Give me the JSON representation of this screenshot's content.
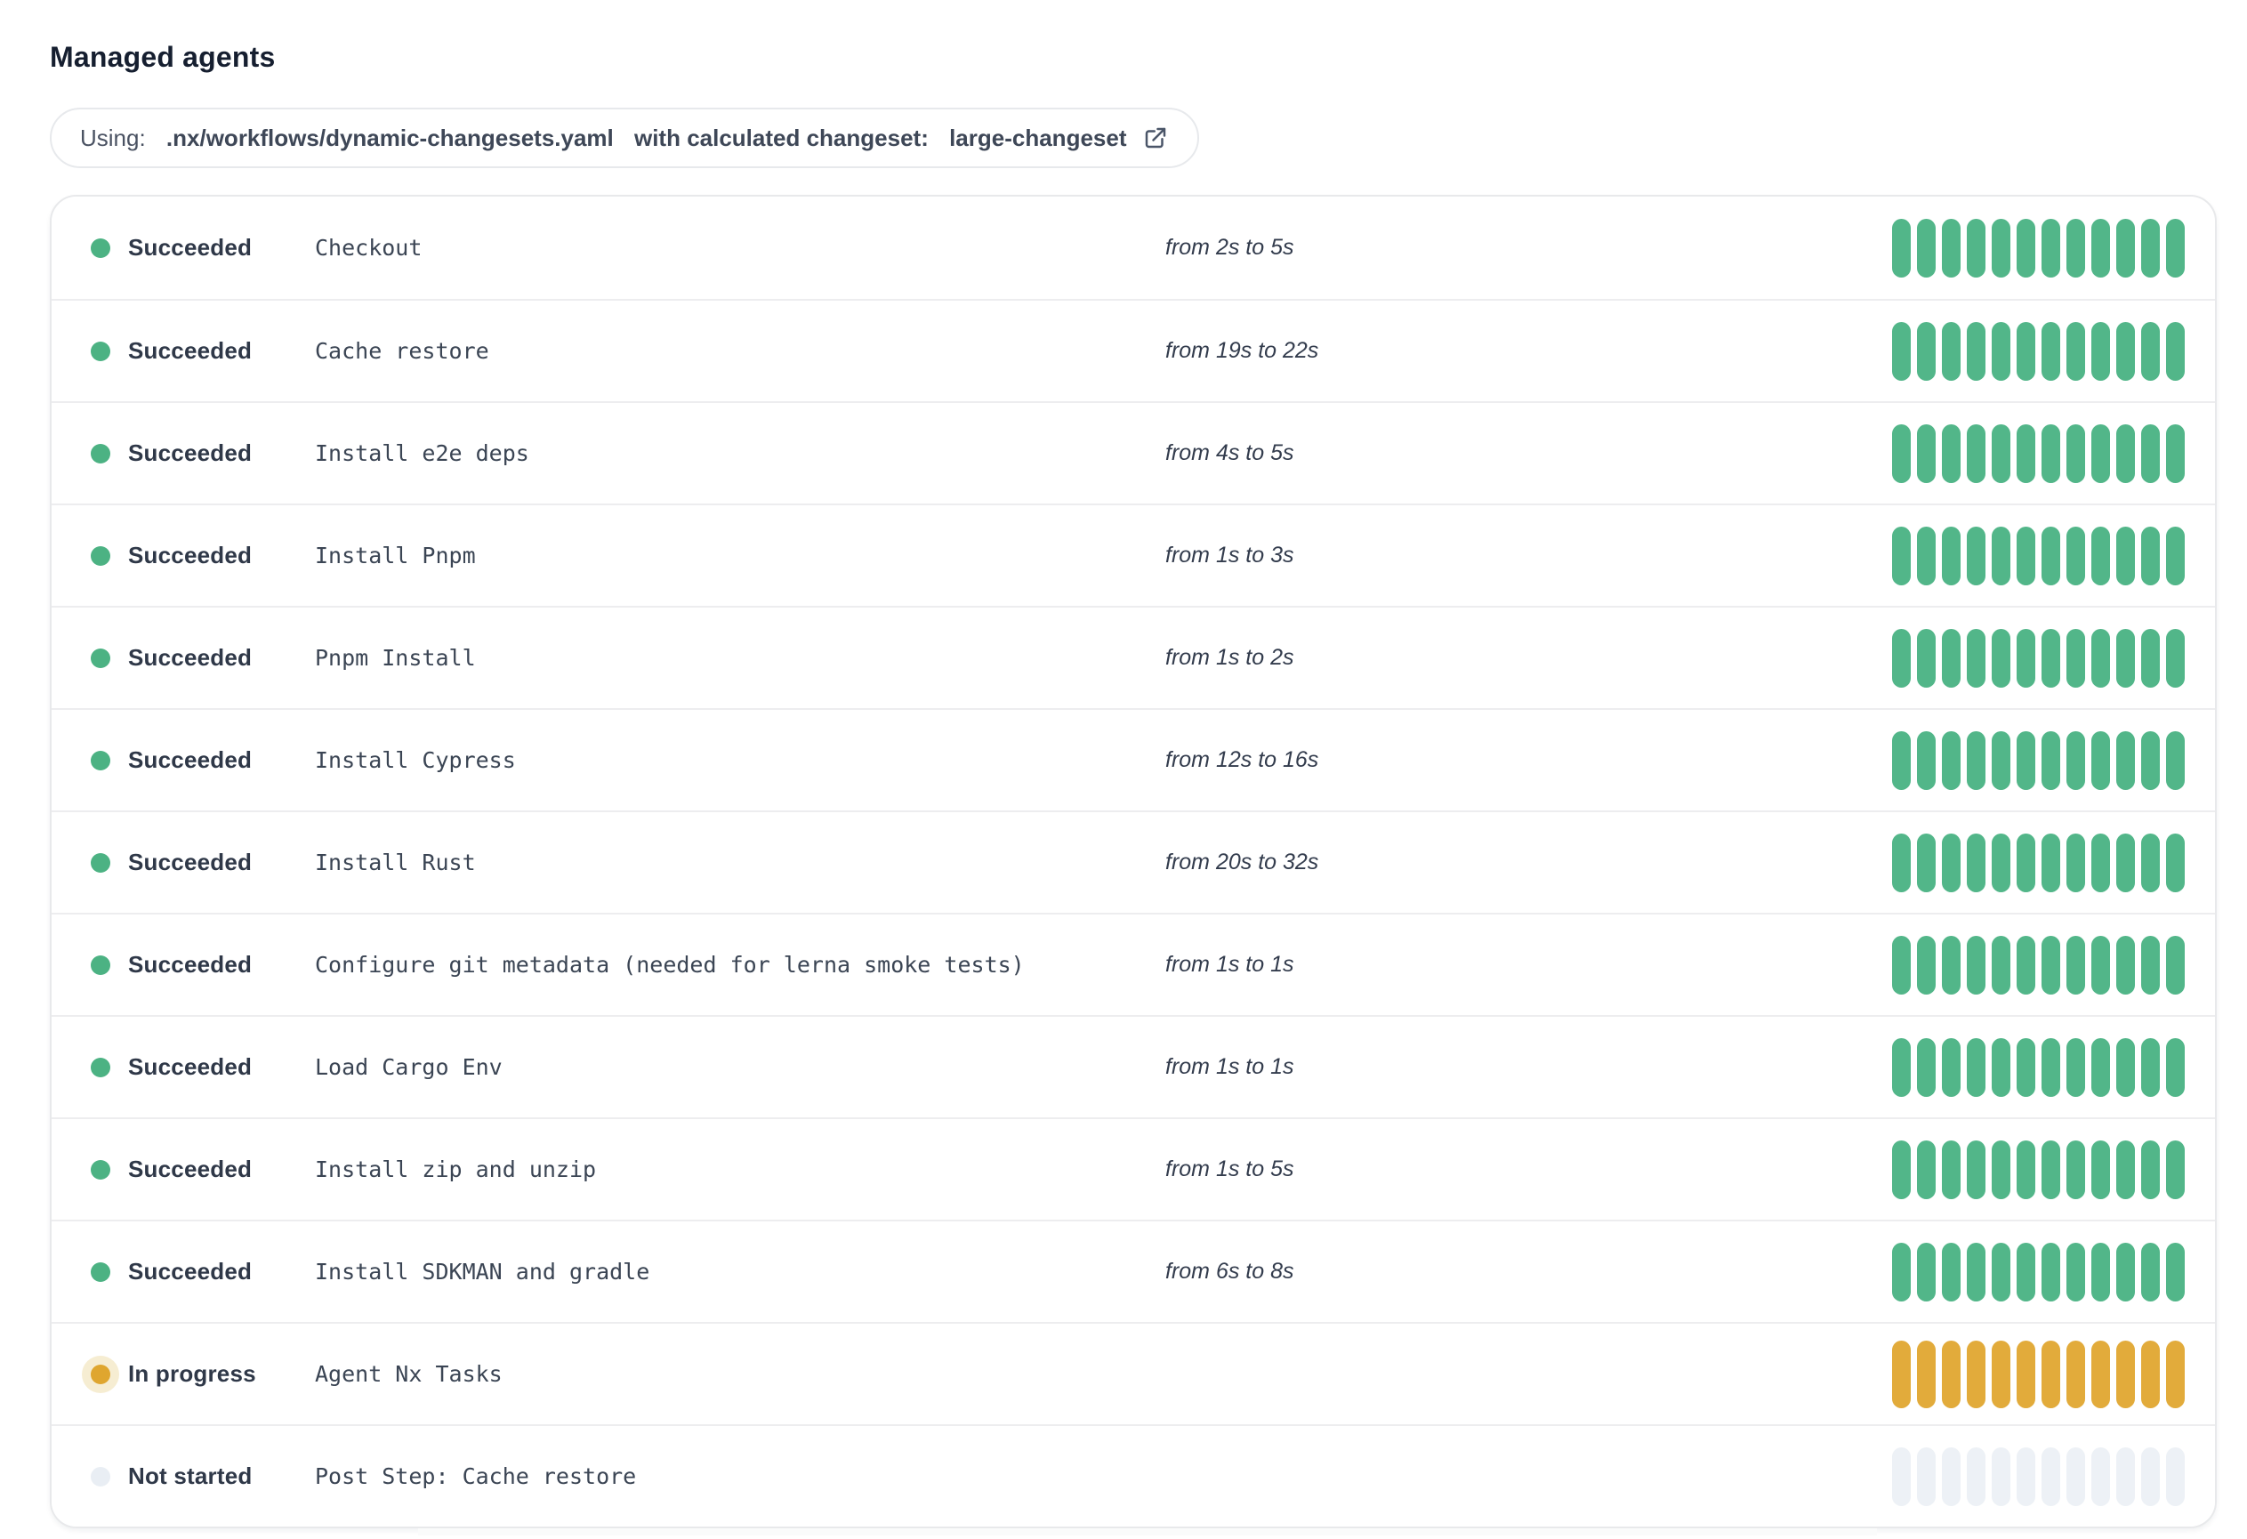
{
  "page": {
    "title": "Managed agents"
  },
  "workflow_banner": {
    "prefix": "Using: ",
    "workflow_file": ".nx/workflows/dynamic-changesets.yaml",
    "middle": " with calculated changeset: ",
    "changeset": "large-changeset",
    "icon": "external-link-icon"
  },
  "colors": {
    "succeeded_dot": "#4cb283",
    "succeeded_bar": "#52b689",
    "in_progress_dot": "#dfa62f",
    "in_progress_halo": "#f6edd2",
    "in_progress_bar": "#e2ab3b",
    "not_started_dot": "#e9eef4",
    "not_started_bar": "#edf1f6",
    "card_border": "#e8e9eb",
    "row_divider": "#ededef",
    "title_text": "#161f30",
    "status_text": "#2f3848",
    "step_text": "#3b4554",
    "duration_text": "#333c4d",
    "pill_text": "#4a5262"
  },
  "agents": {
    "bar_count": 12,
    "statuses": {
      "succeeded": {
        "label": "Succeeded",
        "dot": "#4cb283",
        "bar": "#52b689",
        "halo": false,
        "tall_bars": false
      },
      "in_progress": {
        "label": "In progress",
        "dot": "#dfa62f",
        "bar": "#e2ab3b",
        "halo": true,
        "tall_bars": true
      },
      "not_started": {
        "label": "Not started",
        "dot": "#e9eef4",
        "bar": "#edf1f6",
        "halo": false,
        "tall_bars": false
      }
    },
    "rows": [
      {
        "status": "succeeded",
        "step": "Checkout",
        "duration": "from 2s to 5s"
      },
      {
        "status": "succeeded",
        "step": "Cache restore",
        "duration": "from 19s to 22s"
      },
      {
        "status": "succeeded",
        "step": "Install e2e deps",
        "duration": "from 4s to 5s"
      },
      {
        "status": "succeeded",
        "step": "Install Pnpm",
        "duration": "from 1s to 3s"
      },
      {
        "status": "succeeded",
        "step": "Pnpm Install",
        "duration": "from 1s to 2s"
      },
      {
        "status": "succeeded",
        "step": "Install Cypress",
        "duration": "from 12s to 16s"
      },
      {
        "status": "succeeded",
        "step": "Install Rust",
        "duration": "from 20s to 32s"
      },
      {
        "status": "succeeded",
        "step": "Configure git metadata (needed for lerna smoke tests)",
        "duration": "from 1s to 1s"
      },
      {
        "status": "succeeded",
        "step": "Load Cargo Env",
        "duration": "from 1s to 1s"
      },
      {
        "status": "succeeded",
        "step": "Install zip and unzip",
        "duration": "from 1s to 5s"
      },
      {
        "status": "succeeded",
        "step": "Install SDKMAN and gradle",
        "duration": "from 6s to 8s"
      },
      {
        "status": "in_progress",
        "step": "Agent Nx Tasks",
        "duration": ""
      },
      {
        "status": "not_started",
        "step": "Post Step: Cache restore",
        "duration": ""
      }
    ]
  }
}
